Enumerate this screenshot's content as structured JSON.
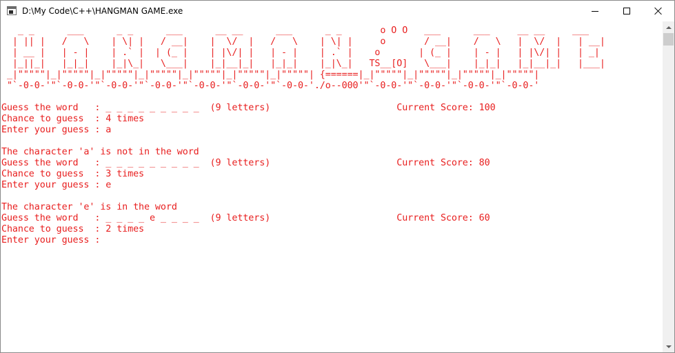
{
  "window": {
    "title": "D:\\My Code\\C++\\HANGMAN GAME.exe",
    "icon": "console-app-icon",
    "controls": {
      "minimize": "minimize-icon",
      "maximize": "maximize-icon",
      "close": "close-icon"
    }
  },
  "colors": {
    "console_text": "#e81e1e",
    "background": "#ffffff"
  },
  "console": {
    "banner": [
      "   _ _      ___      _ _      ___      __ __      ___      _ _       o O O   ___      ___     __ __     ___  ",
      "  | || |   /   \\    | \\| |   / __|    |  \\/  |   /   \\    | \\| |     o       / __|    /   \\   |  \\/  |   | __| ",
      "  | __ |   | - |    | .` |  | (_ |    | |\\/| |   | - |    | .` |    o       | (_ |    | - |   | |\\/| |   | _|  ",
      "  |_||_|   |_|_|    |_|\\_|   \\___|    |_|__|_|   |_|_|    |_|\\_|   TS__[O]   \\___|    |_|_|   |_|__|_|   |___| ",
      " _|\"\"\"\"\"|_|\"\"\"\"\"|_|\"\"\"\"\"|_|\"\"\"\"\"|_|\"\"\"\"\"|_|\"\"\"\"\"|_|\"\"\"\"\"| {======|_|\"\"\"\"\"|_|\"\"\"\"\"|_|\"\"\"\"\"|_|\"\"\"\"\"|",
      " \"`-0-0-'\"`-0-0-'\"`-0-0-'\"`-0-0-'\"`-0-0-'\"`-0-0-'\"`-0-0-'./o--000'\"`-0-0-'\"`-0-0-'\"`-0-0-'\"`-0-0-'"
    ],
    "lines": [
      "Guess the word   : _ _ _ _ _ _ _ _ _  (9 letters)                       Current Score: 100",
      "Chance to guess  : 4 times",
      "Enter your guess : a",
      "",
      "The character 'a' is not in the word",
      "Guess the word   : _ _ _ _ _ _ _ _ _  (9 letters)                       Current Score: 80",
      "Chance to guess  : 3 times",
      "Enter your guess : e",
      "",
      "The character 'e' is in the word",
      "Guess the word   : _ _ _ _ e _ _ _ _  (9 letters)                       Current Score: 60",
      "Chance to guess  : 2 times",
      "Enter your guess :"
    ]
  }
}
